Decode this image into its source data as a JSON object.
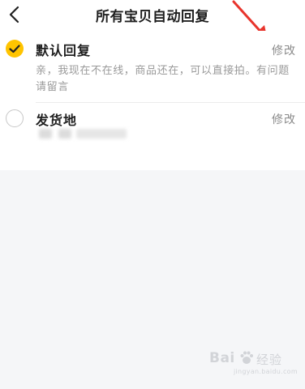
{
  "header": {
    "title": "所有宝贝自动回复",
    "back_icon": "chevron-left-icon"
  },
  "replies": [
    {
      "title": "默认回复",
      "selected": true,
      "edit_label": "修改",
      "description": "亲，我现在不在线，商品还在，可以直接拍。有问题请留言"
    },
    {
      "title": "发货地",
      "selected": false,
      "edit_label": "修改",
      "description": ""
    }
  ],
  "colors": {
    "accent": "#ffc400",
    "annotation_arrow": "#e8342c"
  },
  "watermark": {
    "brand": "Bai",
    "suffix": "经验",
    "url": "jingyan.baidu.com"
  }
}
